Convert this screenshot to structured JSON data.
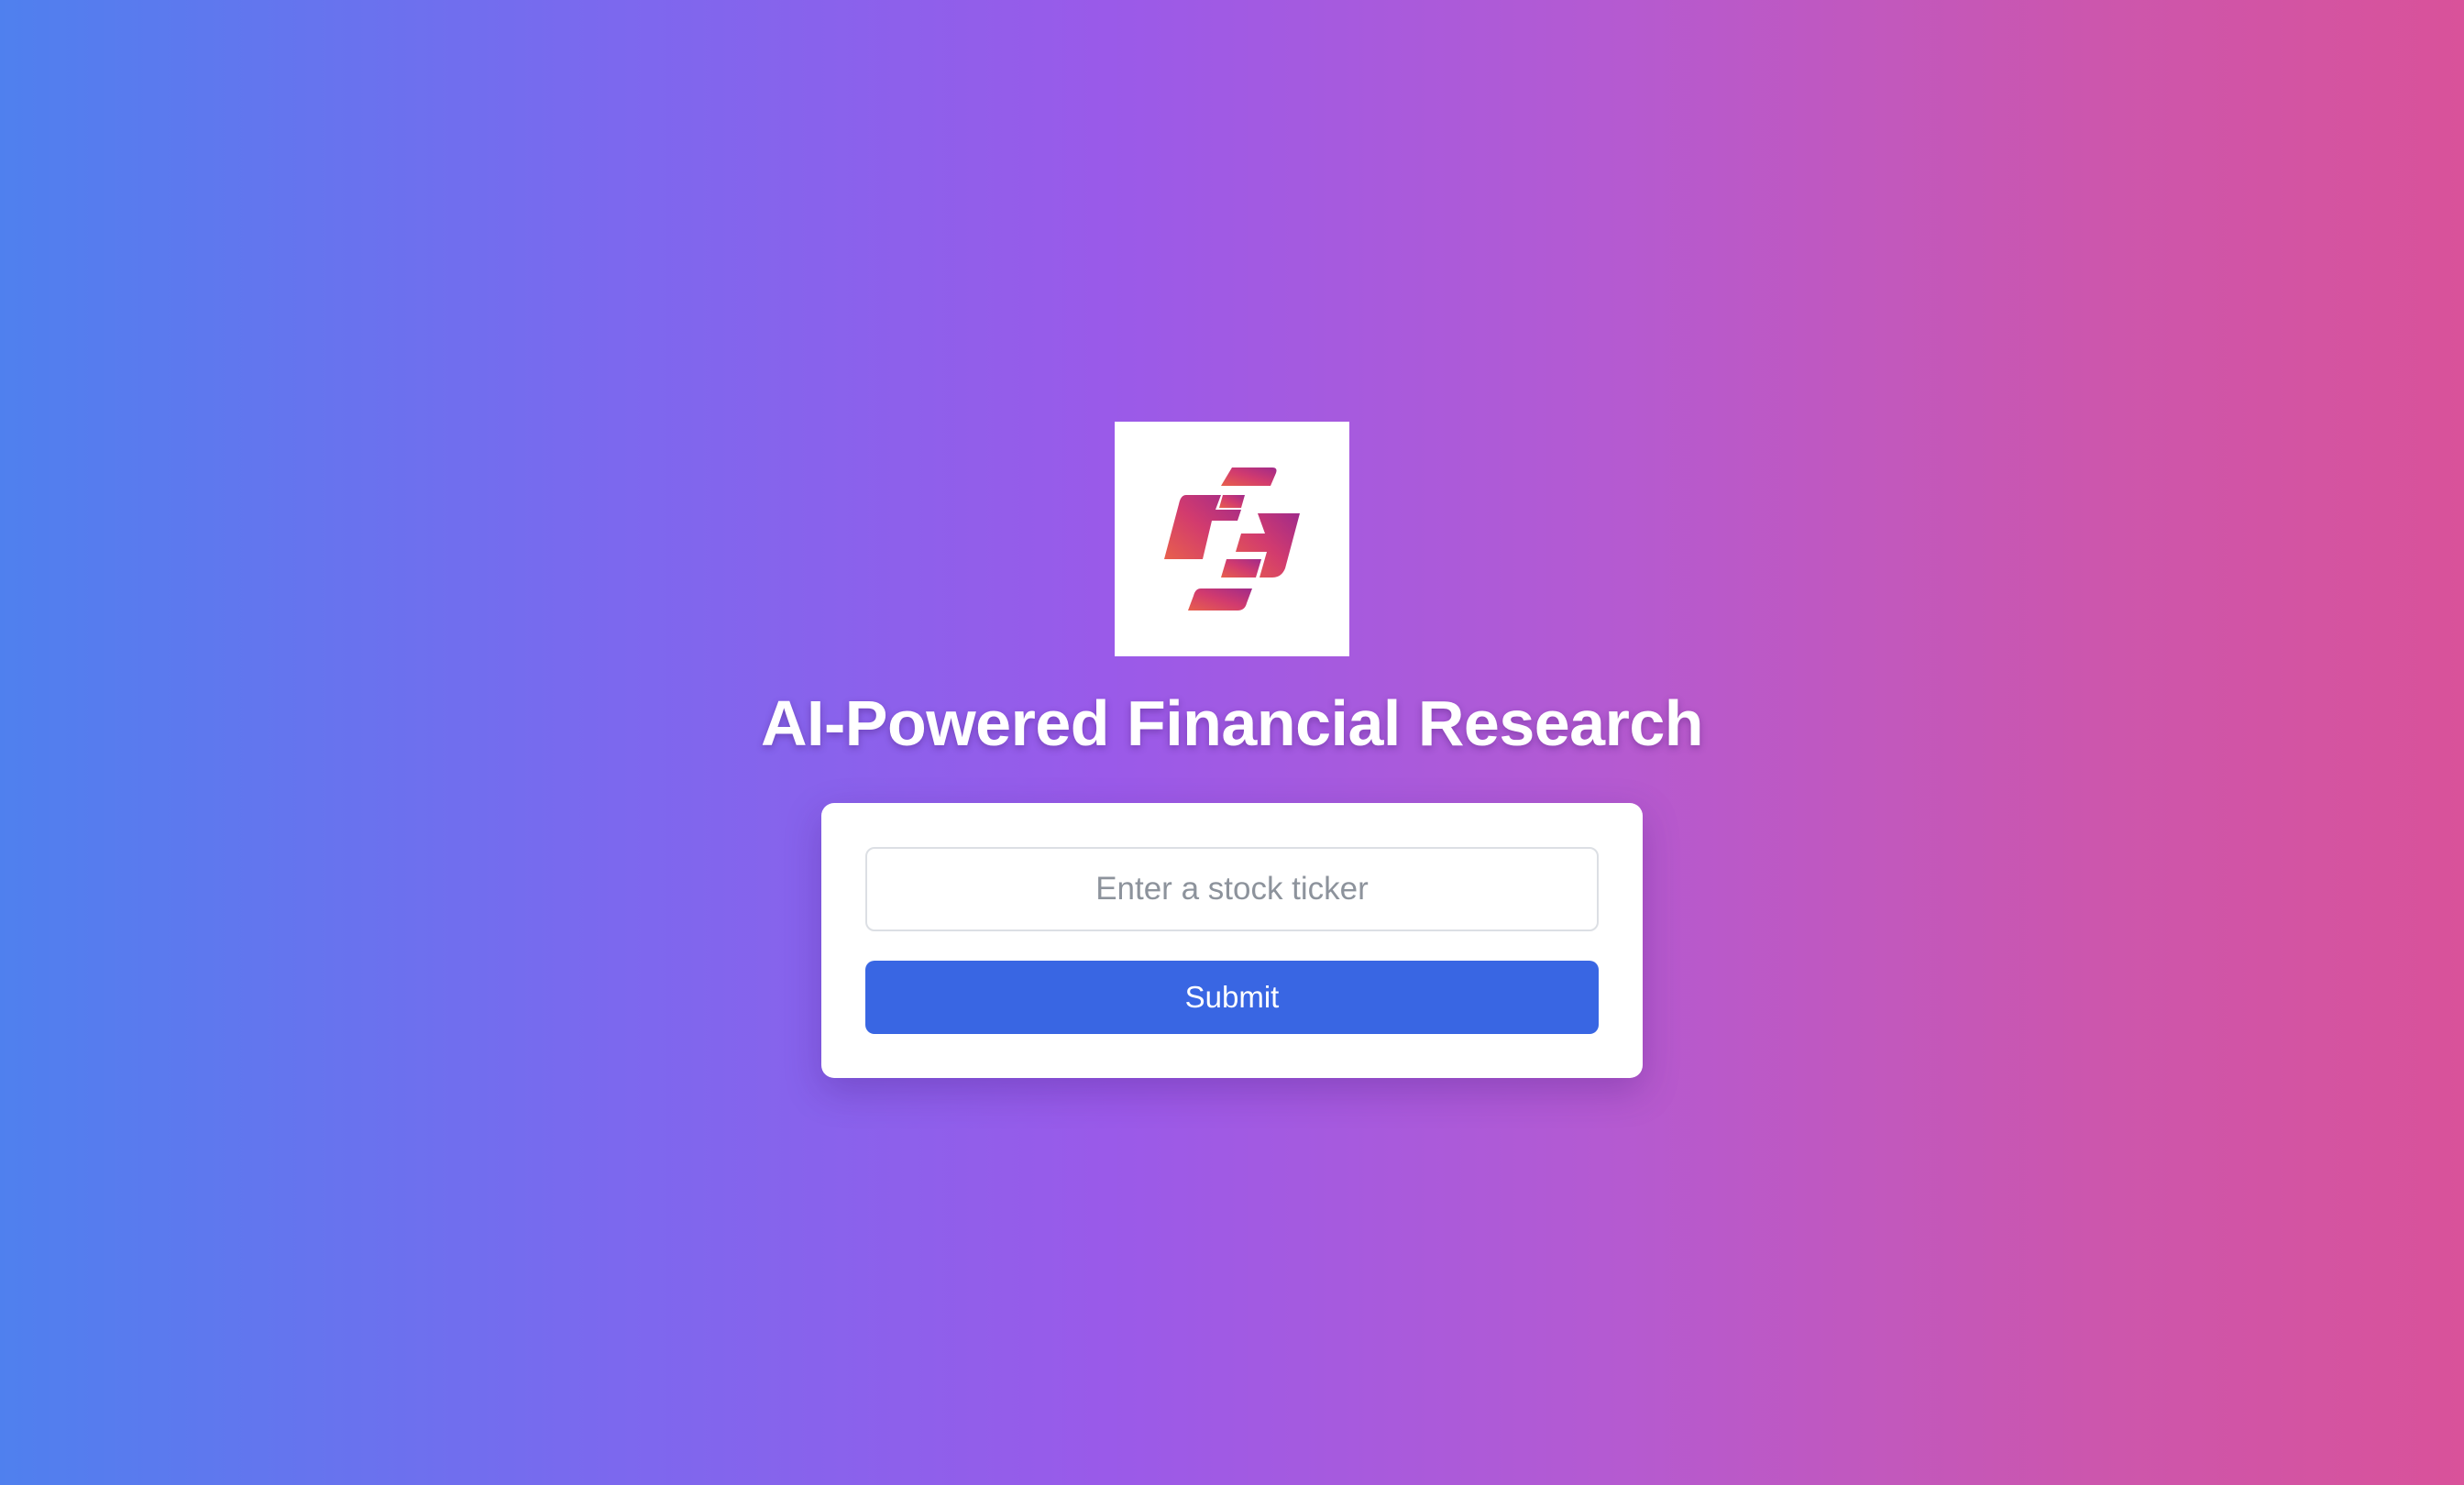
{
  "logo": {
    "icon": "stylized-lightning-blocks-logo",
    "colors": {
      "gradient_start": "#e8604c",
      "gradient_mid": "#d23b6e",
      "gradient_end": "#a02a8a"
    }
  },
  "header": {
    "title": "AI-Powered Financial Research"
  },
  "form": {
    "ticker_placeholder": "Enter a stock ticker",
    "ticker_value": "",
    "submit_label": "Submit"
  },
  "theme": {
    "background_gradient": [
      "#4f80ee",
      "#9a5ae9",
      "#d9529a"
    ],
    "card_background": "#ffffff",
    "button_color": "#3966e3"
  }
}
